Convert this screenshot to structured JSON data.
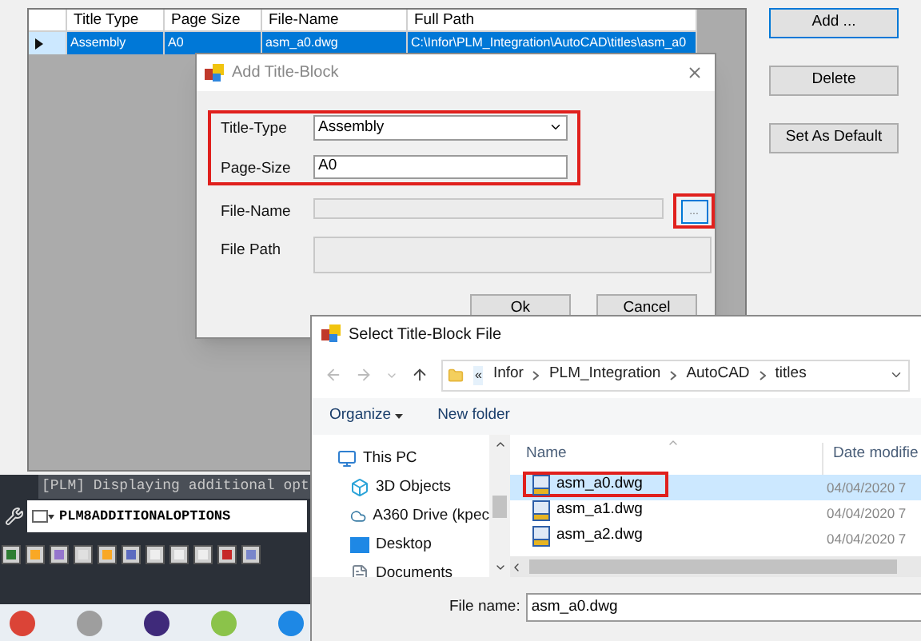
{
  "main_window": {
    "grid": {
      "columns": [
        "Title Type",
        "Page Size",
        "File-Name",
        "Full Path"
      ],
      "rows": [
        {
          "cells": [
            "Assembly",
            "A0",
            "asm_a0.dwg",
            "C:\\Infor\\PLM_Integration\\AutoCAD\\titles\\asm_a0"
          ],
          "selected": true
        }
      ]
    },
    "buttons": [
      {
        "label": "Add ...",
        "focused": true
      },
      {
        "label": "Delete",
        "focused": false
      },
      {
        "label": "Set As Default",
        "focused": false
      }
    ]
  },
  "command_line": {
    "history": "[PLM] Displaying additional opt",
    "input": "PLM8ADDITIONALOPTIONS"
  },
  "add_dialog": {
    "title": "Add Title-Block",
    "fields_highlighted": true,
    "fields": [
      {
        "label": "Title-Type",
        "kind": "combo",
        "value": "Assembly",
        "disabled": false
      },
      {
        "label": "Page-Size",
        "kind": "text",
        "value": "A0",
        "disabled": false
      },
      {
        "label": "File-Name",
        "kind": "browse",
        "disabled": true
      },
      {
        "label": "File Path",
        "kind": "multiline",
        "disabled": true
      }
    ],
    "browse_button": {
      "label": "...",
      "highlighted": true
    },
    "buttons": [
      "Ok",
      "Cancel"
    ]
  },
  "file_dialog": {
    "title": "Select Title-Block File",
    "overflow": "«",
    "breadcrumb": [
      "Infor",
      "PLM_Integration",
      "AutoCAD",
      "titles"
    ],
    "toolbar": [
      {
        "label": "Organize",
        "kind": "menu"
      },
      {
        "label": "New folder",
        "kind": "button"
      }
    ],
    "nav": [
      {
        "label": "This PC",
        "kind": "pc",
        "children": [
          {
            "label": "3D Objects",
            "kind": "objects"
          },
          {
            "label": "A360 Drive (kpec",
            "kind": "cloud"
          },
          {
            "label": "Desktop",
            "kind": "desktop"
          },
          {
            "label": "Documents",
            "kind": "documents"
          }
        ]
      }
    ],
    "columns": [
      "Name",
      "Date modifie"
    ],
    "files": [
      {
        "name": "asm_a0.dwg",
        "date": "04/04/2020 7",
        "selected": true,
        "highlighted": true
      },
      {
        "name": "asm_a1.dwg",
        "date": "04/04/2020 7",
        "selected": false,
        "highlighted": false
      },
      {
        "name": "asm_a2.dwg",
        "date": "04/04/2020 7",
        "selected": false,
        "highlighted": false
      }
    ],
    "file_name": {
      "label": "File name:",
      "value": "asm_a0.dwg"
    }
  }
}
